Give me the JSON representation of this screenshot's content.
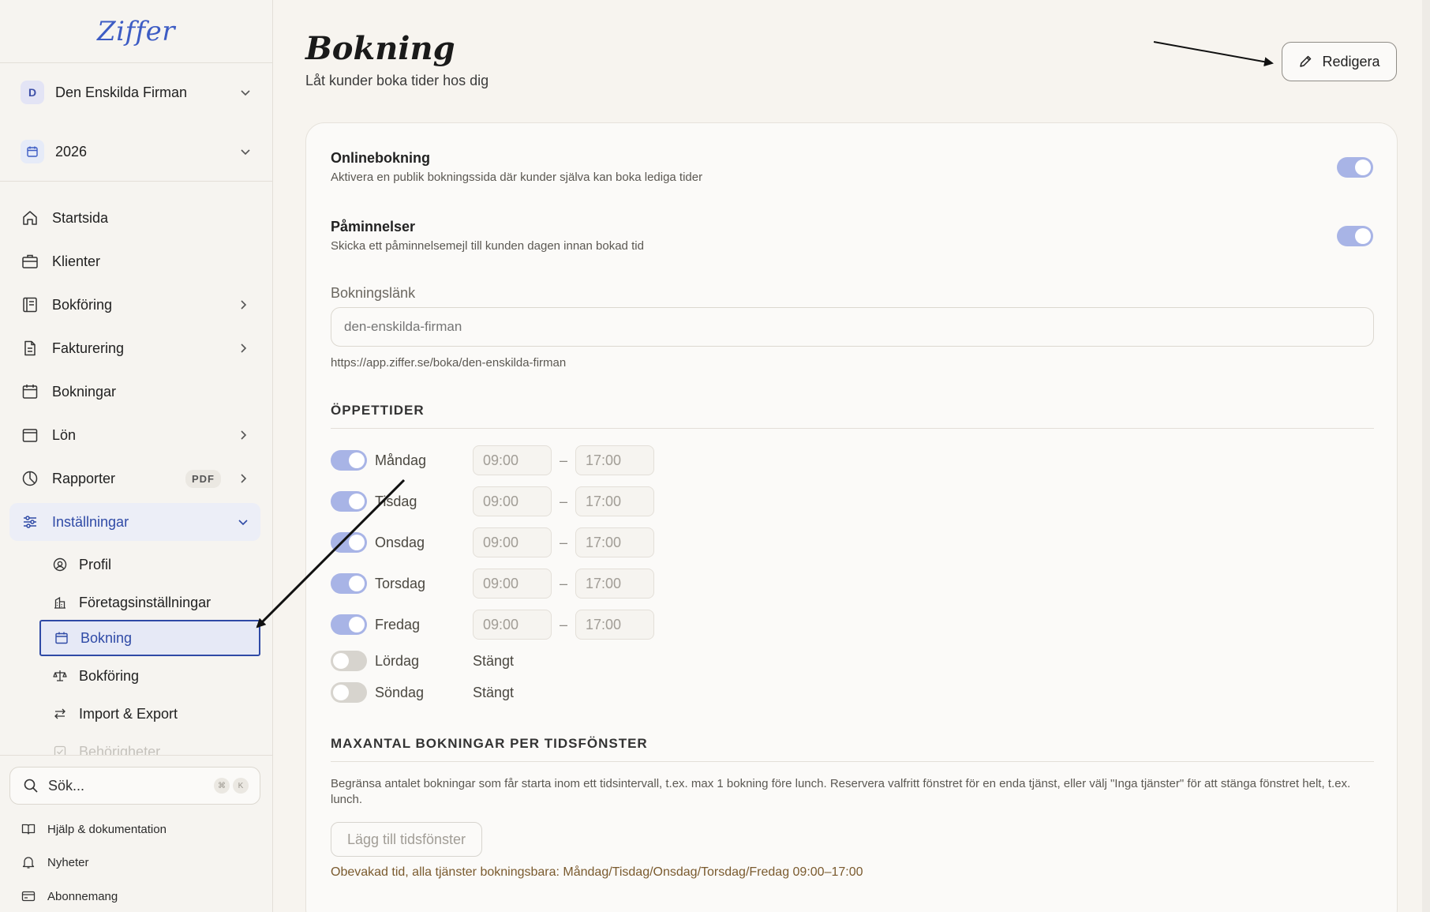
{
  "app": {
    "logo": "Ziffer"
  },
  "sidebar": {
    "company": {
      "initial": "D",
      "name": "Den Enskilda Firman"
    },
    "year": "2026",
    "nav": [
      {
        "label": "Startsida",
        "icon": "home-icon"
      },
      {
        "label": "Klienter",
        "icon": "briefcase-icon"
      },
      {
        "label": "Bokföring",
        "icon": "ledger-icon"
      },
      {
        "label": "Fakturering",
        "icon": "document-icon"
      },
      {
        "label": "Bokningar",
        "icon": "calendar-icon"
      },
      {
        "label": "Lön",
        "icon": "wallet-icon"
      },
      {
        "label": "Rapporter",
        "icon": "pie-chart-icon",
        "badge": "PDF"
      },
      {
        "label": "Inställningar",
        "icon": "sliders-icon"
      }
    ],
    "settings_sub": [
      {
        "label": "Profil",
        "icon": "user-circle-icon"
      },
      {
        "label": "Företagsinställningar",
        "icon": "building-icon"
      },
      {
        "label": "Bokning",
        "icon": "calendar-icon"
      },
      {
        "label": "Bokföring",
        "icon": "scale-icon"
      },
      {
        "label": "Import & Export",
        "icon": "swap-arrows-icon"
      },
      {
        "label": "Behörigheter",
        "icon": "shield-check-icon"
      }
    ],
    "search": {
      "label": "Sök...",
      "shortcut": [
        "⌘",
        "K"
      ]
    },
    "footer": [
      {
        "label": "Hjälp & dokumentation",
        "icon": "book-icon"
      },
      {
        "label": "Nyheter",
        "icon": "bell-icon"
      },
      {
        "label": "Abonnemang",
        "icon": "card-icon"
      }
    ]
  },
  "main": {
    "title": "Bokning",
    "subtitle": "Låt kunder boka tider hos dig",
    "edit_label": "Redigera",
    "online": {
      "title": "Onlinebokning",
      "desc": "Aktivera en publik bokningssida där kunder själva kan boka lediga tider",
      "enabled": true
    },
    "reminders": {
      "title": "Påminnelser",
      "desc": "Skicka ett påminnelsemejl till kunden dagen innan bokad tid",
      "enabled": true
    },
    "booking_link": {
      "label": "Bokningslänk",
      "value": "",
      "placeholder": "den-enskilda-firman",
      "url": "https://app.ziffer.se/boka/den-enskilda-firman"
    },
    "hours": {
      "heading": "ÖPPETTIDER",
      "dash": "–",
      "closed_label": "Stängt",
      "days": [
        {
          "name": "Måndag",
          "open": true,
          "from": "09:00",
          "to": "17:00"
        },
        {
          "name": "Tisdag",
          "open": true,
          "from": "09:00",
          "to": "17:00"
        },
        {
          "name": "Onsdag",
          "open": true,
          "from": "09:00",
          "to": "17:00"
        },
        {
          "name": "Torsdag",
          "open": true,
          "from": "09:00",
          "to": "17:00"
        },
        {
          "name": "Fredag",
          "open": true,
          "from": "09:00",
          "to": "17:00"
        },
        {
          "name": "Lördag",
          "open": false
        },
        {
          "name": "Söndag",
          "open": false
        }
      ]
    },
    "limits": {
      "heading": "MAXANTAL BOKNINGAR PER TIDSFÖNSTER",
      "desc": "Begränsa antalet bokningar som får starta inom ett tidsintervall, t.ex. max 1 bokning före lunch. Reservera valfritt fönstret för en enda tjänst, eller välj \"Inga tjänster\" för att stänga fönstret helt, t.ex. lunch.",
      "add_label": "Lägg till tidsfönster",
      "unguarded": "Obevakad tid, alla tjänster bokningsbara: Måndag/Tisdag/Onsdag/Torsdag/Fredag 09:00–17:00"
    }
  },
  "colors": {
    "accent": "#2f4aa6",
    "toggle_on": "#a8b4e6",
    "toggle_off": "#d7d4ce",
    "background": "#f7f4ef"
  }
}
